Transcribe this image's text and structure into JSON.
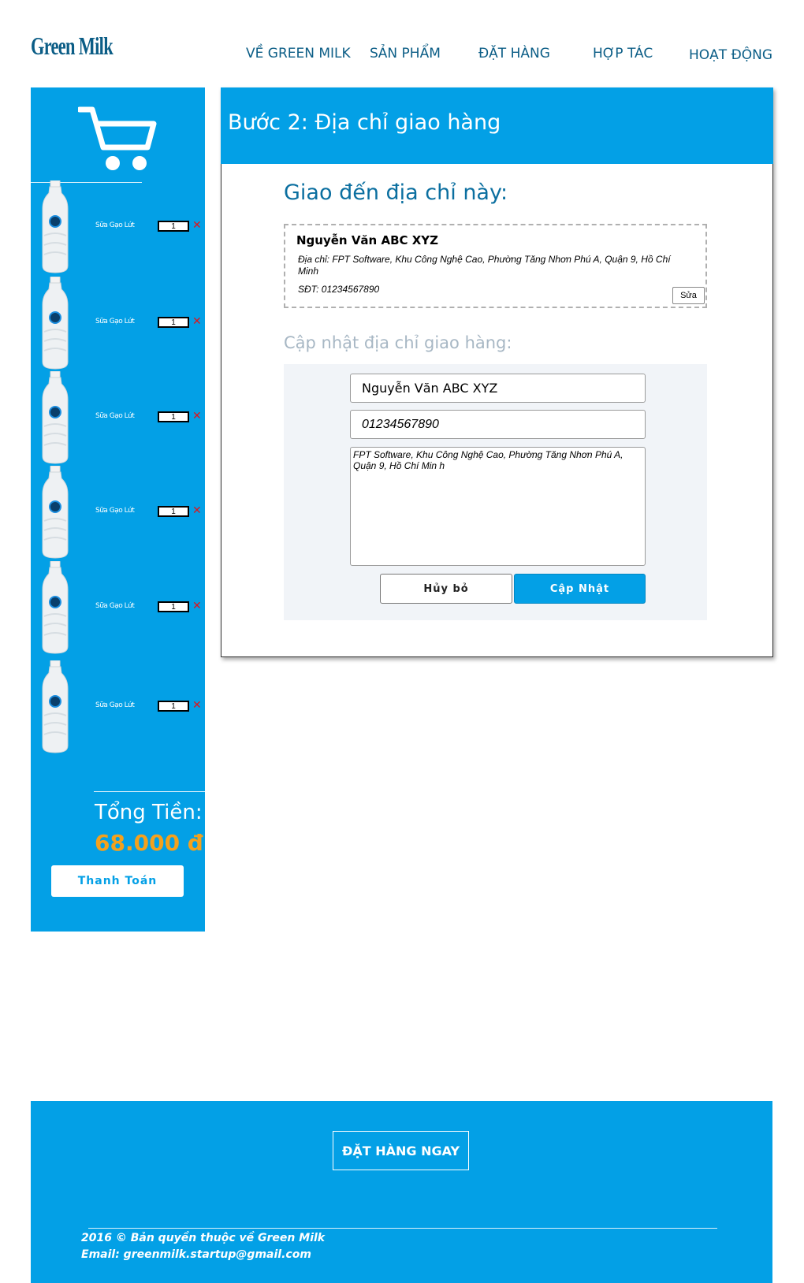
{
  "brand": {
    "logo": "Green Milk"
  },
  "nav": [
    {
      "label": "VỀ GREEN MILK"
    },
    {
      "label": "SẢN PHẨM"
    },
    {
      "label": "ĐẶT HÀNG"
    },
    {
      "label": "HỢP TÁC"
    },
    {
      "label": "HOẠT ĐỘNG"
    }
  ],
  "cart": {
    "icon": "shopping-cart-icon",
    "items": [
      {
        "name": "Sữa Gạo Lứt",
        "qty": "1"
      },
      {
        "name": "Sữa Gạo Lứt",
        "qty": "1"
      },
      {
        "name": "Sữa Gạo Lứt",
        "qty": "1"
      },
      {
        "name": "Sữa Gạo Lứt",
        "qty": "1"
      },
      {
        "name": "Sữa Gạo Lứt",
        "qty": "1"
      },
      {
        "name": "Sữa Gạo Lứt",
        "qty": "1"
      }
    ],
    "remove_symbol": "✕",
    "total_label": "Tổng Tiền:",
    "total_value": "68.000 đ",
    "checkout_label": "Thanh Toán"
  },
  "step": {
    "title": "Bước 2: Địa chỉ giao hàng",
    "deliver_heading": "Giao đến địa chỉ này:",
    "address_card": {
      "name": "Nguyễn Văn ABC XYZ",
      "address": "Địa chỉ: FPT Software, Khu Công Nghệ Cao, Phường Tăng Nhơn Phú A, Quận 9, Hồ Chí Minh",
      "phone": "SĐT: 01234567890",
      "edit_label": "Sửa"
    },
    "update_heading": "Cập nhật địa chỉ giao hàng:",
    "form": {
      "name_value": "Nguyễn Văn ABC XYZ",
      "phone_value": "01234567890",
      "address_value": "FPT Software, Khu Công Nghệ Cao, Phường Tăng Nhơn Phú A, Quận 9, Hồ Chí Min h",
      "cancel_label": "Hủy bỏ",
      "update_label": "Cập Nhật"
    }
  },
  "footer": {
    "order_now": "ĐẶT HÀNG NGAY",
    "copyright": "2016 © Bản quyền thuộc về Green Milk",
    "email": "Email: greenmilk.startup@gmail.com"
  },
  "colors": {
    "accent": "#03a0e6",
    "nav": "#0b5d86",
    "total": "#f5a11c",
    "remove": "#e0141b"
  }
}
